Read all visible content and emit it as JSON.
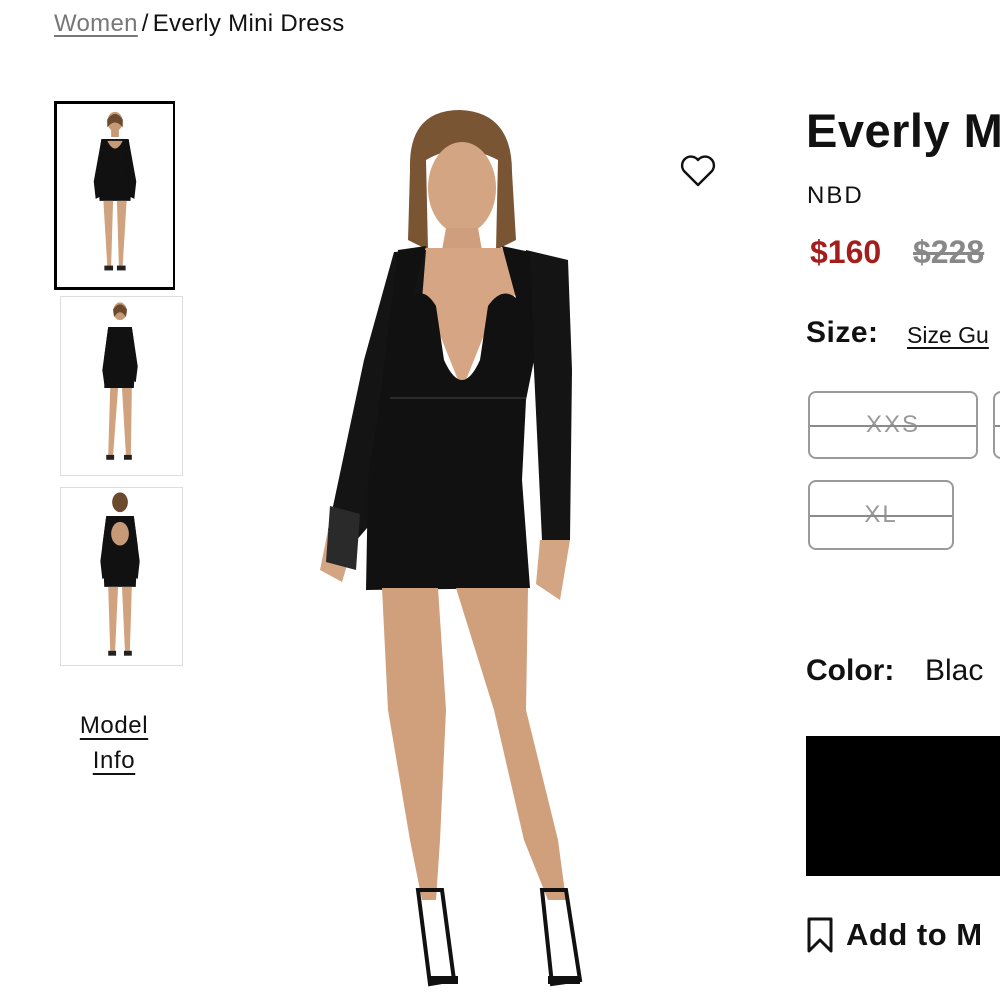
{
  "breadcrumb": {
    "parent": "Women",
    "separator": "/",
    "current": "Everly Mini Dress"
  },
  "model_info": {
    "line1": "Model",
    "line2": "Info"
  },
  "product": {
    "title": "Everly M",
    "brand": "NBD",
    "sale_price": "$160",
    "original_price": "$228"
  },
  "size": {
    "label": "Size:",
    "guide_link": "Size Gu",
    "options": [
      {
        "label": "XXS",
        "available": false
      },
      {
        "label": "XL",
        "available": false
      }
    ]
  },
  "color": {
    "label": "Color:",
    "value": "Blac",
    "swatch_hex": "#000000"
  },
  "actions": {
    "add_to_wishlist": "Add to M"
  },
  "icons": {
    "wishlist": "heart-icon",
    "bookmark": "bookmark-icon"
  },
  "colors": {
    "sale": "#a51c1c",
    "muted": "#888888",
    "dress": "#111111"
  }
}
